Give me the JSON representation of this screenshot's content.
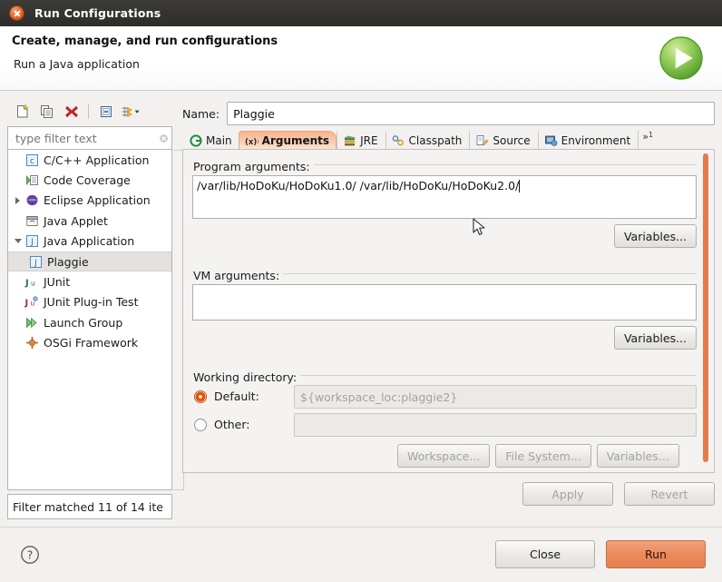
{
  "window": {
    "title": "Run Configurations",
    "close_icon": "close-icon"
  },
  "header": {
    "title": "Create, manage, and run configurations",
    "subtitle": "Run a Java application",
    "banner_icon": "run-green-circle-icon"
  },
  "left_panel": {
    "toolbar": [
      {
        "name": "new-launch-configuration-button",
        "icon": "new-document-icon"
      },
      {
        "name": "duplicate-launch-configuration-button",
        "icon": "copy-icon"
      },
      {
        "name": "delete-launch-configuration-button",
        "icon": "delete-red-x-icon"
      },
      {
        "name": "collapse-all-button",
        "icon": "collapse-all-icon"
      },
      {
        "name": "filter-launch-configurations-button",
        "icon": "filter-arrows-icon"
      }
    ],
    "filter": {
      "placeholder": "type filter text",
      "value": "",
      "clear_icon": "clear-icon"
    },
    "tree": [
      {
        "label": "C/C++ Application",
        "icon": "c-application-icon",
        "twisty": "none",
        "indent": 0,
        "selected": false
      },
      {
        "label": "Code Coverage",
        "icon": "code-coverage-icon",
        "twisty": "none",
        "indent": 0,
        "selected": false
      },
      {
        "label": "Eclipse Application",
        "icon": "eclipse-application-icon",
        "twisty": "collapsed",
        "indent": 0,
        "selected": false
      },
      {
        "label": "Java Applet",
        "icon": "java-applet-icon",
        "twisty": "none",
        "indent": 0,
        "selected": false
      },
      {
        "label": "Java Application",
        "icon": "java-application-icon",
        "twisty": "expanded",
        "indent": 0,
        "selected": false
      },
      {
        "label": "Plaggie",
        "icon": "java-application-icon",
        "twisty": "none",
        "indent": 1,
        "selected": true
      },
      {
        "label": "JUnit",
        "icon": "junit-icon",
        "twisty": "none",
        "indent": 0,
        "selected": false
      },
      {
        "label": "JUnit Plug-in Test",
        "icon": "junit-plugin-icon",
        "twisty": "none",
        "indent": 0,
        "selected": false
      },
      {
        "label": "Launch Group",
        "icon": "launch-group-icon",
        "twisty": "none",
        "indent": 0,
        "selected": false
      },
      {
        "label": "OSGi Framework",
        "icon": "osgi-framework-icon",
        "twisty": "none",
        "indent": 0,
        "selected": false
      }
    ],
    "status": "Filter matched 11 of 14 ite"
  },
  "right_panel": {
    "name_label": "Name:",
    "name_value": "Plaggie",
    "tabs": [
      {
        "label": "Main",
        "icon": "main-tab-icon",
        "selected": false
      },
      {
        "label": "Arguments",
        "icon": "arguments-tab-icon",
        "selected": true
      },
      {
        "label": "JRE",
        "icon": "jre-tab-icon",
        "selected": false
      },
      {
        "label": "Classpath",
        "icon": "classpath-tab-icon",
        "selected": false
      },
      {
        "label": "Source",
        "icon": "source-tab-icon",
        "selected": false
      },
      {
        "label": "Environment",
        "icon": "environment-tab-icon",
        "selected": false
      }
    ],
    "tab_overflow_label": "»",
    "tab_overflow_count": "1",
    "program_arguments": {
      "label": "Program arguments:",
      "value": "/var/lib/HoDoKu/HoDoKu1.0/ /var/lib/HoDoKu/HoDoKu2.0/",
      "variables_button": "Variables..."
    },
    "vm_arguments": {
      "label": "VM arguments:",
      "value": "",
      "variables_button": "Variables..."
    },
    "working_directory": {
      "label": "Working directory:",
      "default_label": "Default:",
      "default_value": "${workspace_loc:plaggie2}",
      "default_selected": true,
      "other_label": "Other:",
      "other_value": "",
      "other_selected": false,
      "workspace_button": "Workspace...",
      "file_system_button": "File System...",
      "variables_button": "Variables..."
    },
    "apply_button": "Apply",
    "revert_button": "Revert"
  },
  "footer": {
    "help_icon": "help-question-icon",
    "close_button": "Close",
    "run_button": "Run"
  },
  "colors": {
    "accent_orange": "#e8794a",
    "run_button": "#ec8a5d",
    "radio_selected": "#e2530f",
    "titlebar": "#2e2d2a",
    "panel_bg": "#f4f3f2"
  }
}
